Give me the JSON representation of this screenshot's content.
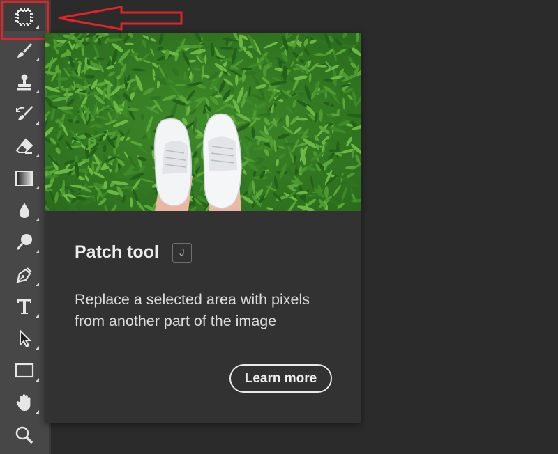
{
  "toolbar": {
    "tools": [
      {
        "name": "select-subject-tool",
        "icon": "marquee-chip-icon",
        "active": true
      },
      {
        "name": "brush-tool",
        "icon": "brush-icon"
      },
      {
        "name": "clone-stamp-tool",
        "icon": "stamp-icon"
      },
      {
        "name": "history-brush-tool",
        "icon": "history-brush-icon"
      },
      {
        "name": "eraser-tool",
        "icon": "eraser-icon"
      },
      {
        "name": "gradient-tool",
        "icon": "gradient-icon"
      },
      {
        "name": "blur-tool",
        "icon": "drop-icon"
      },
      {
        "name": "dodge-tool",
        "icon": "dodge-icon"
      },
      {
        "name": "pen-tool",
        "icon": "pen-icon"
      },
      {
        "name": "type-tool",
        "icon": "type-icon"
      },
      {
        "name": "path-selection-tool",
        "icon": "pointer-arrow-icon"
      },
      {
        "name": "rectangle-tool",
        "icon": "rectangle-icon"
      },
      {
        "name": "hand-tool",
        "icon": "hand-icon"
      },
      {
        "name": "zoom-tool",
        "icon": "zoom-icon"
      }
    ]
  },
  "annotation": {
    "highlight_color": "#e2232a",
    "arrow_color": "#e2232a"
  },
  "tooltip": {
    "title": "Patch tool",
    "shortcut": "J",
    "description": "Replace a selected area with pixels from another part of the image",
    "learn_more": "Learn more"
  },
  "colors": {
    "toolbar": "#474747",
    "tooltip": "#323232",
    "background": "#2b2b2b"
  }
}
